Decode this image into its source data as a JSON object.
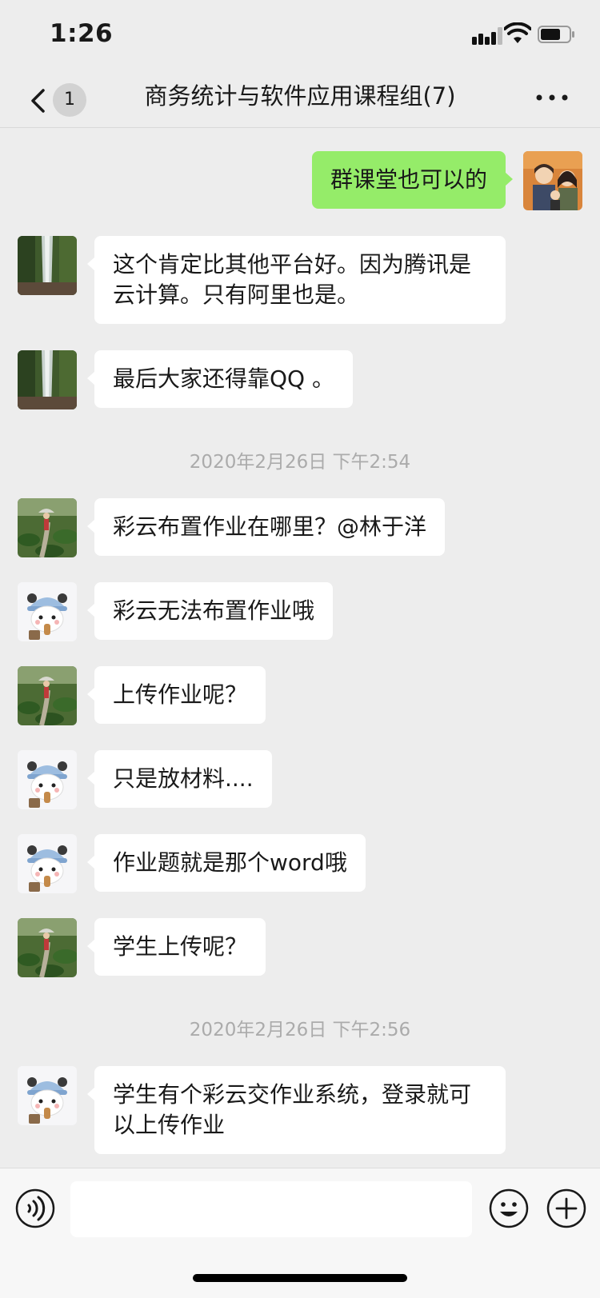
{
  "status_bar": {
    "time": "1:26",
    "icons": [
      "cellular-signal-icon",
      "wifi-icon",
      "battery-icon"
    ]
  },
  "nav": {
    "unread_count": "1",
    "title": "商务统计与软件应用课程组(7)",
    "icons": [
      "back-chevron-icon",
      "more-icon"
    ]
  },
  "messages": [
    {
      "side": "right",
      "avatar": "cartoon-family-avatar",
      "text": "群课堂也可以的"
    },
    {
      "side": "left",
      "avatar": "waterfall-avatar",
      "text": "这个肯定比其他平台好。因为腾讯是云计算。只有阿里也是。"
    },
    {
      "side": "left",
      "avatar": "waterfall-avatar",
      "text": "最后大家还得靠QQ 。"
    },
    {
      "type": "time",
      "text": "2020年2月26日 下午2:54"
    },
    {
      "side": "left",
      "avatar": "lotus-girl-avatar",
      "text": "彩云布置作业在哪里？@林于洋"
    },
    {
      "side": "left",
      "avatar": "panda-cartoon-avatar",
      "text": "彩云无法布置作业哦"
    },
    {
      "side": "left",
      "avatar": "lotus-girl-avatar",
      "text": "上传作业呢？"
    },
    {
      "side": "left",
      "avatar": "panda-cartoon-avatar",
      "text": "只是放材料...."
    },
    {
      "side": "left",
      "avatar": "panda-cartoon-avatar",
      "text": "作业题就是那个word哦"
    },
    {
      "side": "left",
      "avatar": "lotus-girl-avatar",
      "text": "学生上传呢？"
    },
    {
      "type": "time",
      "text": "2020年2月26日 下午2:56"
    },
    {
      "side": "left",
      "avatar": "panda-cartoon-avatar",
      "text": "学生有个彩云交作业系统，登录就可以上传作业"
    }
  ],
  "input_bar": {
    "value": "",
    "icons": [
      "voice-icon",
      "emoji-icon",
      "plus-icon"
    ]
  },
  "colors": {
    "background": "#ededed",
    "sent_bubble": "#95ec69",
    "received_bubble": "#ffffff",
    "timestamp_text": "#ababab"
  }
}
